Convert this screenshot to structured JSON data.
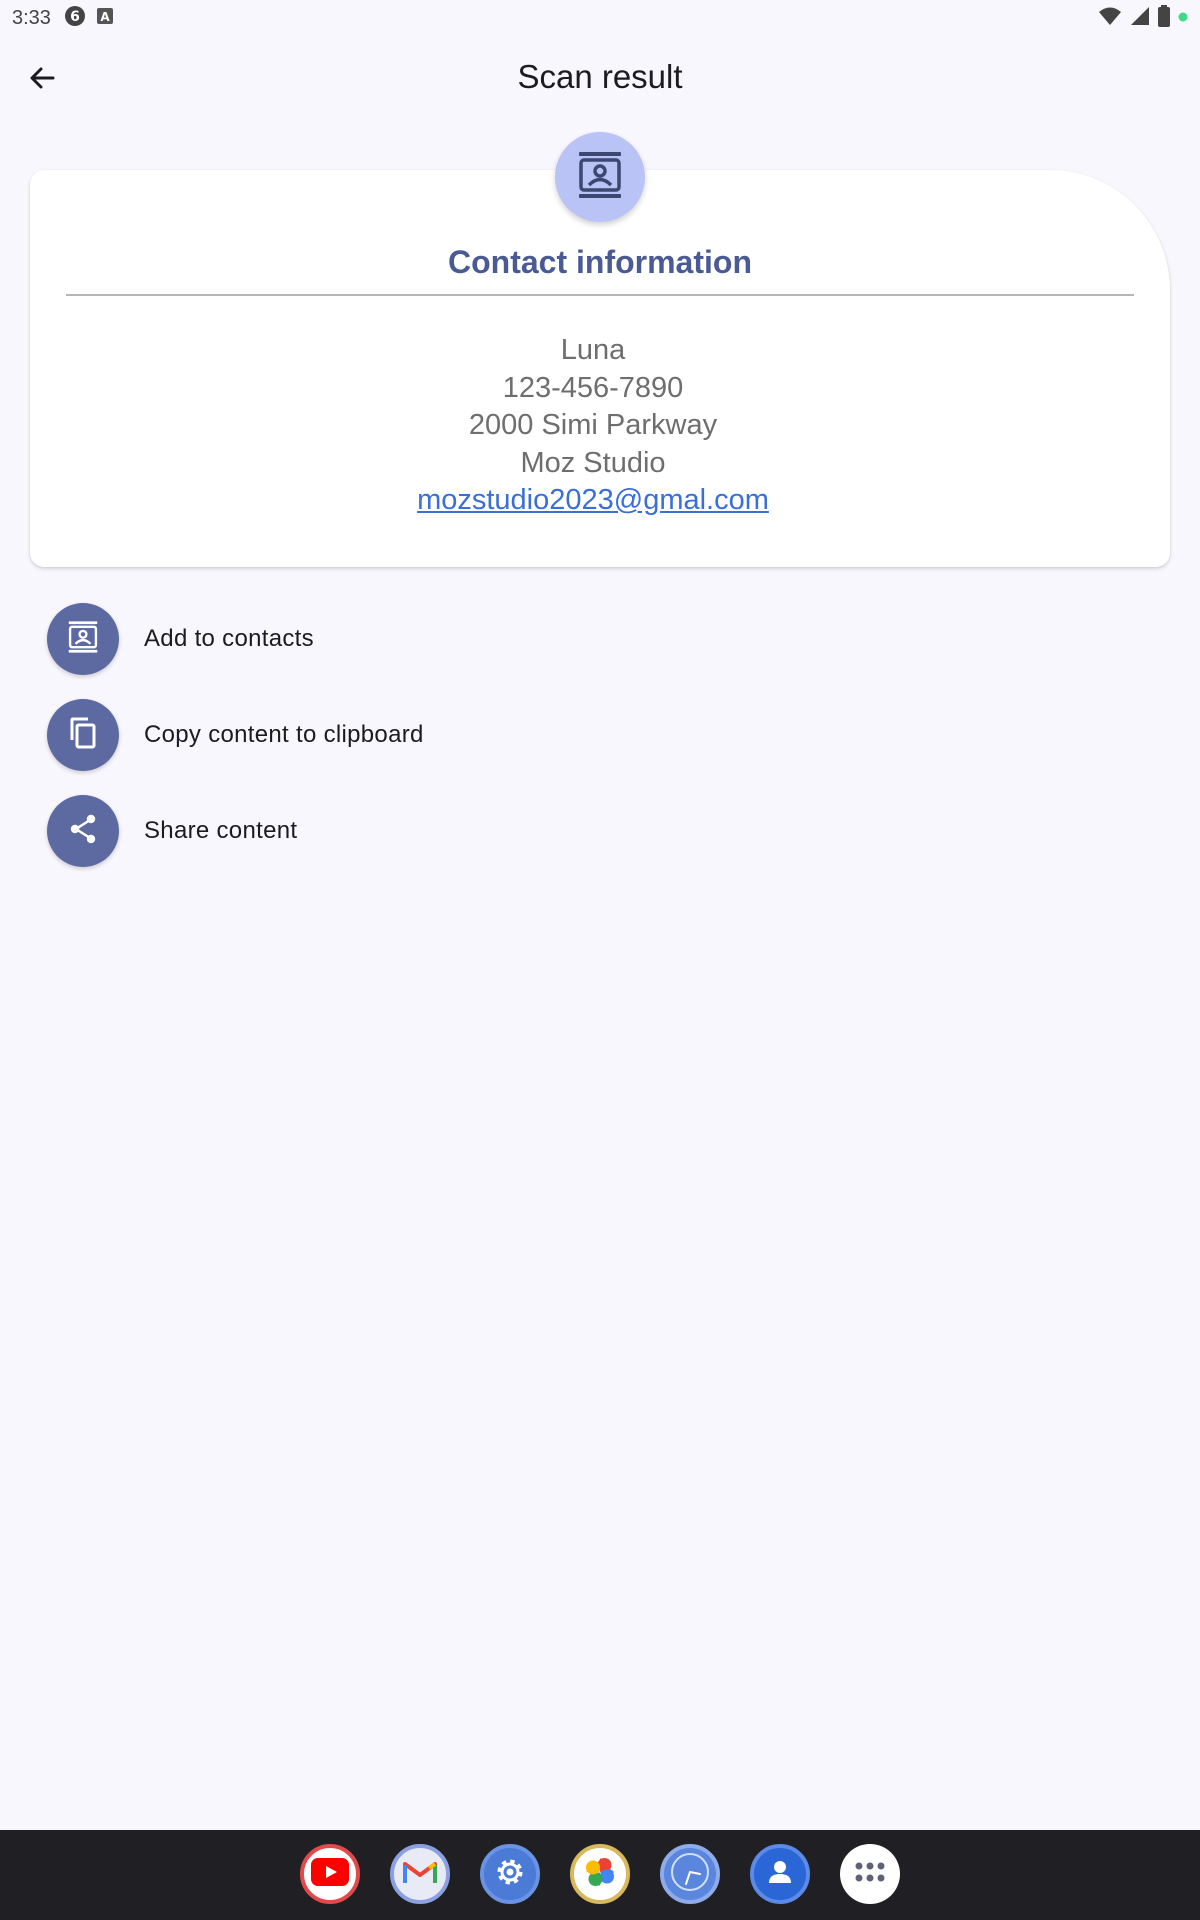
{
  "status_bar": {
    "time": "3:33",
    "left_icons": [
      "notification-6-icon",
      "keyboard-a-icon"
    ],
    "right_icons": [
      "wifi-icon",
      "signal-icon",
      "battery-icon",
      "dot-icon"
    ]
  },
  "header": {
    "title": "Scan result",
    "back_icon": "arrow-back-icon"
  },
  "card": {
    "badge_icon": "contact-card-icon",
    "title": "Contact information",
    "lines": [
      "Luna",
      "123-456-7890",
      "2000 Simi Parkway",
      "Moz Studio"
    ],
    "email": "mozstudio2023@gmal.com"
  },
  "actions": [
    {
      "label": "Add to contacts",
      "icon": "contact-card-icon"
    },
    {
      "label": "Copy content to clipboard",
      "icon": "copy-icon"
    },
    {
      "label": "Share content",
      "icon": "share-icon"
    }
  ],
  "dock": {
    "apps": [
      "youtube-icon",
      "gmail-icon",
      "settings-icon",
      "photos-icon",
      "clock-icon",
      "contacts-icon",
      "app-drawer-icon"
    ]
  },
  "colors": {
    "background": "#f8f7fd",
    "accent": "#5d6aa1",
    "title_accent": "#4a5a94",
    "link": "#3a6fd8",
    "badge": "#b9c3f5"
  }
}
